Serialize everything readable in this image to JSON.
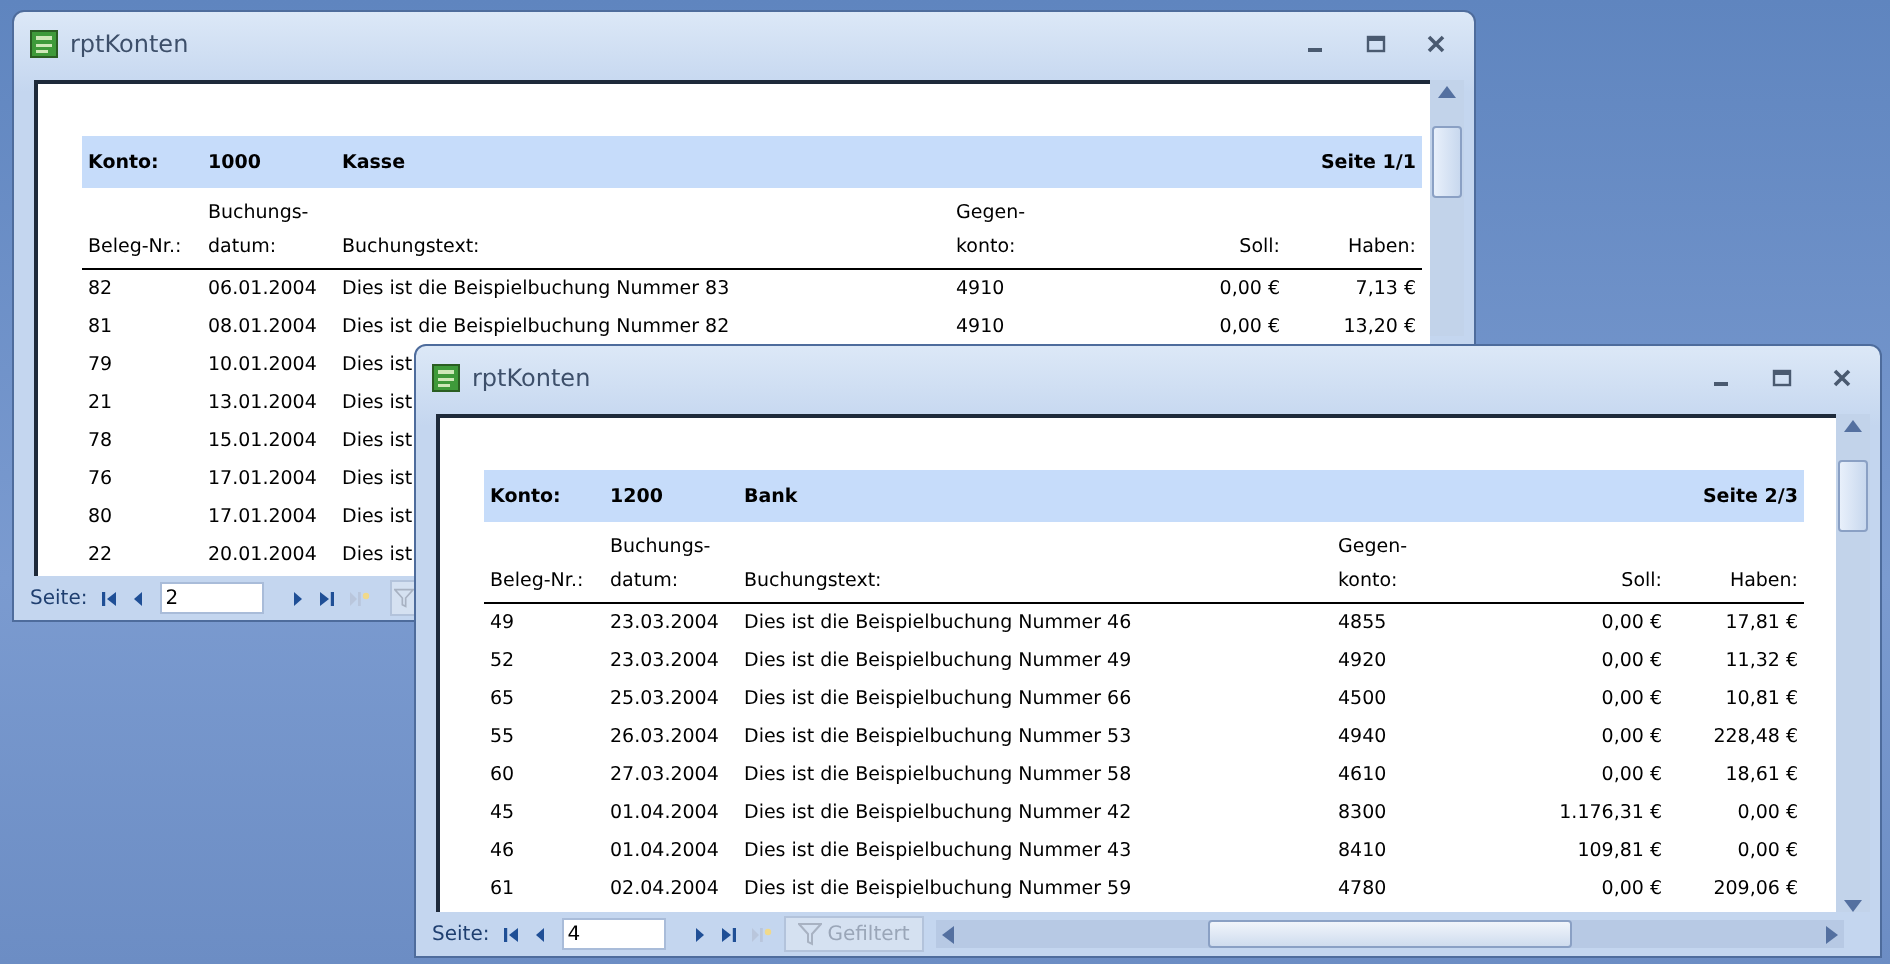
{
  "windows": [
    {
      "title": "rptKonten",
      "header": {
        "konto_label": "Konto:",
        "konto": "1000",
        "name": "Kasse",
        "page": "Seite 1/1"
      },
      "columns": [
        "Beleg-Nr.:",
        "Buchungs-datum:",
        "Buchungstext:",
        "Gegen-konto:",
        "Soll:",
        "Haben:"
      ],
      "rows": [
        [
          "82",
          "06.01.2004",
          "Dies ist die Beispielbuchung Nummer 83",
          "4910",
          "0,00 €",
          "7,13 €"
        ],
        [
          "81",
          "08.01.2004",
          "Dies ist die Beispielbuchung Nummer 82",
          "4910",
          "0,00 €",
          "13,20 €"
        ],
        [
          "79",
          "10.01.2004",
          "Dies ist"
        ],
        [
          "21",
          "13.01.2004",
          "Dies ist"
        ],
        [
          "78",
          "15.01.2004",
          "Dies ist"
        ],
        [
          "76",
          "17.01.2004",
          "Dies ist"
        ],
        [
          "80",
          "17.01.2004",
          "Dies ist"
        ],
        [
          "22",
          "20.01.2004",
          "Dies ist"
        ]
      ],
      "status": {
        "label": "Seite:",
        "page_value": "2",
        "filter": {
          "disabled": true
        }
      }
    },
    {
      "title": "rptKonten",
      "header": {
        "konto_label": "Konto:",
        "konto": "1200",
        "name": "Bank",
        "page": "Seite 2/3"
      },
      "columns": [
        "Beleg-Nr.:",
        "Buchungs-datum:",
        "Buchungstext:",
        "Gegen-konto:",
        "Soll:",
        "Haben:"
      ],
      "rows": [
        [
          "49",
          "23.03.2004",
          "Dies ist die Beispielbuchung Nummer 46",
          "4855",
          "0,00 €",
          "17,81 €"
        ],
        [
          "52",
          "23.03.2004",
          "Dies ist die Beispielbuchung Nummer 49",
          "4920",
          "0,00 €",
          "11,32 €"
        ],
        [
          "65",
          "25.03.2004",
          "Dies ist die Beispielbuchung Nummer 66",
          "4500",
          "0,00 €",
          "10,81 €"
        ],
        [
          "55",
          "26.03.2004",
          "Dies ist die Beispielbuchung Nummer 53",
          "4940",
          "0,00 €",
          "228,48 €"
        ],
        [
          "60",
          "27.03.2004",
          "Dies ist die Beispielbuchung Nummer 58",
          "4610",
          "0,00 €",
          "18,61 €"
        ],
        [
          "45",
          "01.04.2004",
          "Dies ist die Beispielbuchung Nummer 42",
          "8300",
          "1.176,31 €",
          "0,00 €"
        ],
        [
          "46",
          "01.04.2004",
          "Dies ist die Beispielbuchung Nummer 43",
          "8410",
          "109,81 €",
          "0,00 €"
        ],
        [
          "61",
          "02.04.2004",
          "Dies ist die Beispielbuchung Nummer 59",
          "4780",
          "0,00 €",
          "209,06 €"
        ]
      ],
      "status": {
        "label": "Seite:",
        "page_value": "4",
        "filter": {
          "label": "Gefiltert",
          "disabled": true
        }
      }
    }
  ]
}
